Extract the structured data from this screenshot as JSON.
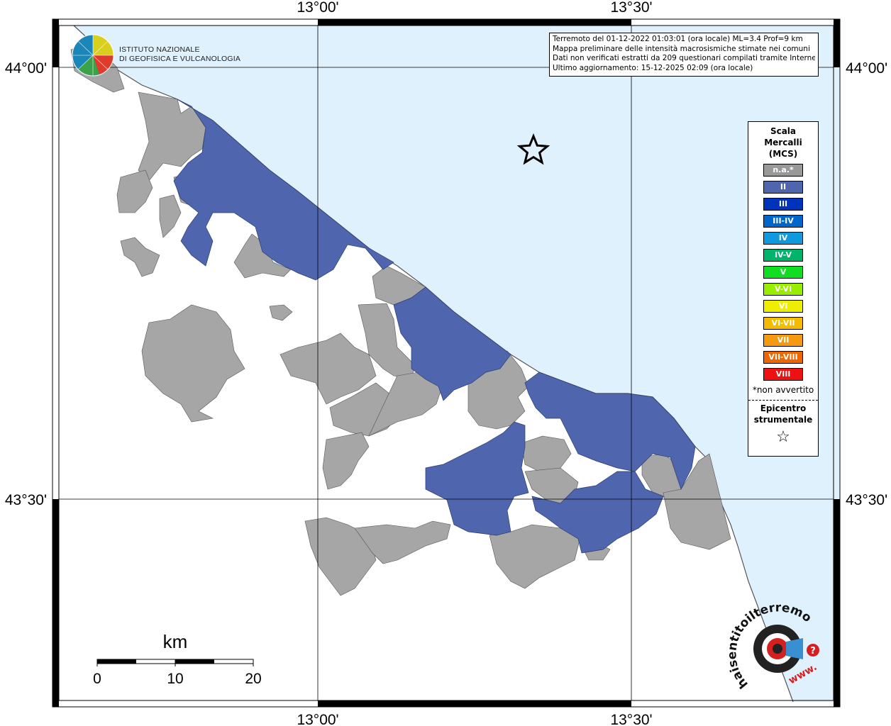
{
  "frame": {
    "top_labels": [
      "13°00'",
      "13°30'"
    ],
    "bottom_labels": [
      "13°00'",
      "13°30'"
    ],
    "left_labels": [
      "44°00'",
      "43°30'"
    ],
    "right_labels": [
      "44°00'",
      "43°30'"
    ]
  },
  "info": {
    "line1": "Terremoto del 01-12-2022 01:03:01 (ora locale) ML=3.4 Prof=9 km",
    "line2": "Mappa preliminare delle intensità macrosismiche stimate nei comuni",
    "line3": "Dati non verificati estratti da 209 questionari compilati tramite Internet.",
    "line4": "Ultimo aggiornamento: 15-12-2025 02:09 (ora locale)"
  },
  "logo": {
    "line1": "ISTITUTO NAZIONALE",
    "line2": "DI GEOFISICA E VULCANOLOGIA"
  },
  "legend": {
    "title_line1": "Scala",
    "title_line2": "Mercalli",
    "title_line3": "(MCS)",
    "items": [
      {
        "label": "n.a.*",
        "color": "#999999"
      },
      {
        "label": "II",
        "color": "#4f66ae"
      },
      {
        "label": "III",
        "color": "#0033bb"
      },
      {
        "label": "III-IV",
        "color": "#0066cc"
      },
      {
        "label": "IV",
        "color": "#1199dd"
      },
      {
        "label": "IV-V",
        "color": "#00b36b"
      },
      {
        "label": "V",
        "color": "#11dd22"
      },
      {
        "label": "V-VI",
        "color": "#99ee00"
      },
      {
        "label": "VI",
        "color": "#eeee00"
      },
      {
        "label": "VI-VII",
        "color": "#f5bb00"
      },
      {
        "label": "VII",
        "color": "#f59a10"
      },
      {
        "label": "VII-VIII",
        "color": "#ee6600"
      },
      {
        "label": "VIII",
        "color": "#ee1111"
      }
    ],
    "note": "*non avvertito",
    "epicenter_line1": "Epicentro",
    "epicenter_line2": "strumentale",
    "epicenter_symbol": "☆"
  },
  "scale_bar": {
    "unit": "km",
    "labels": [
      "0",
      "10",
      "20"
    ]
  },
  "badge": {
    "text": "haisentitoilterremoto.it",
    "prefix": "www.",
    "question": "?"
  },
  "colors": {
    "sea": "#dff1fd",
    "na": "#a6a6a6",
    "intensity_II": "#4f66ae"
  }
}
